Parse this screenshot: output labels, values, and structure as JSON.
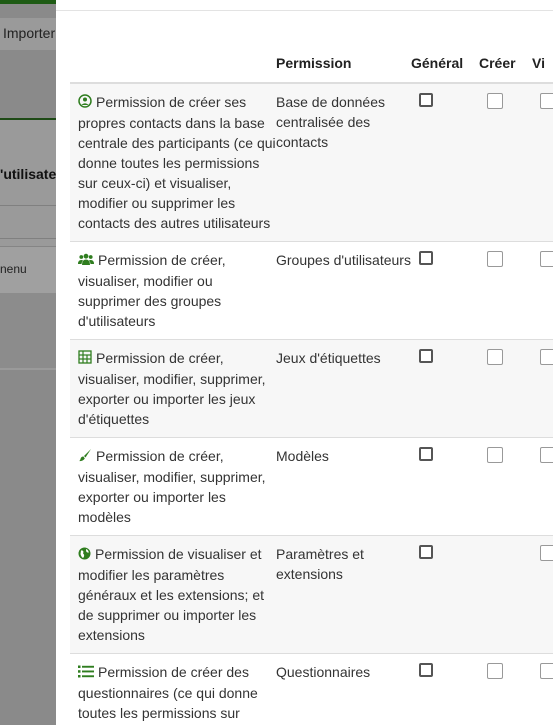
{
  "background": {
    "import_label": "Importer",
    "users_label": "'utilisate",
    "menu_label": "nenu"
  },
  "table": {
    "headers": [
      "",
      "Permission",
      "Général",
      "Créer",
      "Vi"
    ],
    "rows": [
      {
        "icon": "user-circle-icon",
        "description": "Permission de créer ses propres contacts dans la base centrale des participants (ce qui donne toutes les permissions sur ceux-ci) et visualiser, modifier ou supprimer les contacts des autres utilisateurs",
        "permission": "Base de données centralisée des contacts",
        "has_create": true,
        "has_view": true
      },
      {
        "icon": "users-group-icon",
        "description": "Permission de créer, visualiser, modifier ou supprimer des groupes d'utilisateurs",
        "permission": "Groupes d'utilisateurs",
        "has_create": true,
        "has_view": true
      },
      {
        "icon": "label-set-icon",
        "description": "Permission de créer, visualiser, modifier, supprimer, exporter ou importer les jeux d'étiquettes",
        "permission": "Jeux d'étiquettes",
        "has_create": true,
        "has_view": true
      },
      {
        "icon": "brush-icon",
        "description": "Permission de créer, visualiser, modifier, supprimer, exporter ou importer les modèles",
        "permission": "Modèles",
        "has_create": true,
        "has_view": true
      },
      {
        "icon": "globe-icon",
        "description": "Permission de visualiser et modifier les paramètres généraux et les extensions; et de supprimer ou importer les extensions",
        "permission": "Paramètres et extensions",
        "has_create": false,
        "has_view": true
      },
      {
        "icon": "list-icon",
        "description": "Permission de créer des questionnaires (ce qui donne toutes les permissions sur",
        "permission": "Questionnaires",
        "has_create": true,
        "has_view": true
      }
    ]
  },
  "colors": {
    "accent": "#2f7d1f",
    "overlay": "#7a7a7a"
  }
}
